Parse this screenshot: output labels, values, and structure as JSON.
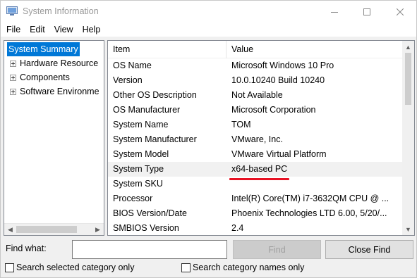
{
  "window": {
    "title": "System Information"
  },
  "menu": [
    "File",
    "Edit",
    "View",
    "Help"
  ],
  "tree": {
    "root": "System Summary",
    "children": [
      "Hardware Resource",
      "Components",
      "Software Environme"
    ]
  },
  "list": {
    "headers": {
      "item": "Item",
      "value": "Value"
    },
    "rows": [
      {
        "item": "OS Name",
        "value": "Microsoft Windows 10 Pro"
      },
      {
        "item": "Version",
        "value": "10.0.10240 Build 10240"
      },
      {
        "item": "Other OS Description",
        "value": "Not Available"
      },
      {
        "item": "OS Manufacturer",
        "value": "Microsoft Corporation"
      },
      {
        "item": "System Name",
        "value": "TOM"
      },
      {
        "item": "System Manufacturer",
        "value": "VMware, Inc."
      },
      {
        "item": "System Model",
        "value": "VMware Virtual Platform"
      },
      {
        "item": "System Type",
        "value": "x64-based PC"
      },
      {
        "item": "System SKU",
        "value": ""
      },
      {
        "item": "Processor",
        "value": "Intel(R) Core(TM) i7-3632QM CPU @ ..."
      },
      {
        "item": "BIOS Version/Date",
        "value": "Phoenix Technologies LTD 6.00, 5/20/..."
      },
      {
        "item": "SMBIOS Version",
        "value": "2.4"
      }
    ],
    "highlight_color": "#e81123"
  },
  "find": {
    "label": "Find what:",
    "value": "",
    "find_button": "Find",
    "close_button": "Close Find",
    "check_selected": "Search selected category only",
    "check_names": "Search category names only"
  },
  "colors": {
    "selection": "#0078d7",
    "annotation": "#e81123"
  }
}
